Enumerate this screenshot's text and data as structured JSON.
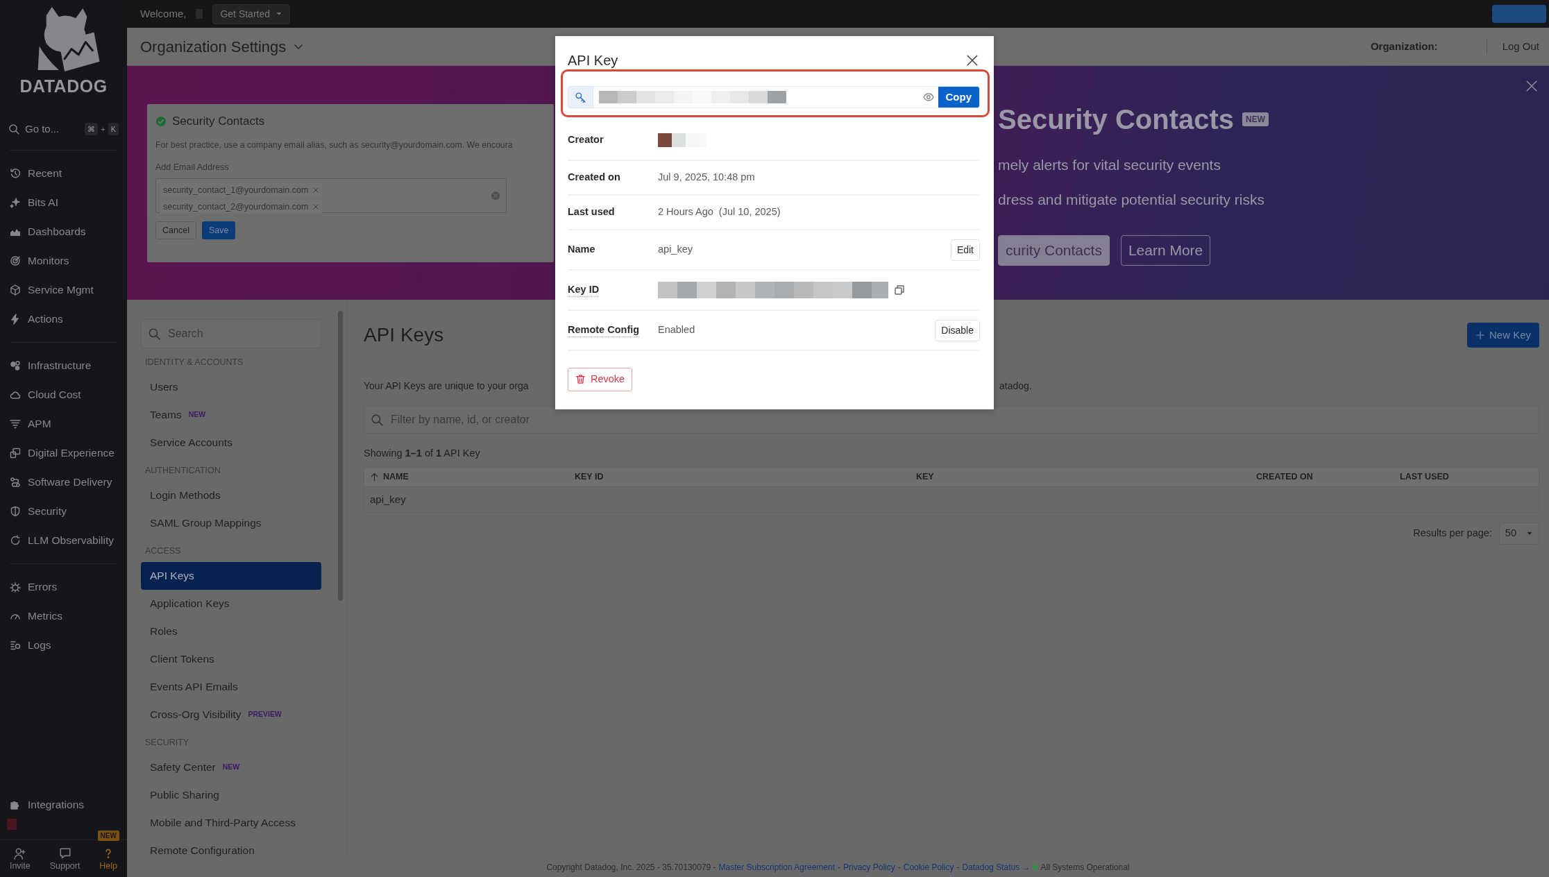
{
  "top_bar": {
    "greeting": "Welcome,",
    "menu_button": "Get Started"
  },
  "main_nav": {
    "logo": "DATADOG",
    "goto": {
      "label": "Go to...",
      "keys": [
        "⌘",
        "K"
      ],
      "joiner": "+"
    },
    "groups": [
      {
        "items": [
          {
            "label": "Recent"
          },
          {
            "label": "Bits AI"
          },
          {
            "label": "Dashboards"
          },
          {
            "label": "Monitors"
          },
          {
            "label": "Service Mgmt"
          },
          {
            "label": "Actions"
          }
        ]
      },
      {
        "items": [
          {
            "label": "Infrastructure"
          },
          {
            "label": "Cloud Cost"
          },
          {
            "label": "APM"
          },
          {
            "label": "Digital Experience"
          },
          {
            "label": "Software Delivery"
          },
          {
            "label": "Security"
          },
          {
            "label": "LLM Observability"
          }
        ]
      },
      {
        "items": [
          {
            "label": "Errors"
          },
          {
            "label": "Metrics"
          },
          {
            "label": "Logs"
          }
        ]
      }
    ],
    "integrations": "Integrations",
    "bottom_buttons": [
      {
        "label": "Invite",
        "highlighted": false
      },
      {
        "label": "Support",
        "highlighted": false
      },
      {
        "label": "Help",
        "highlighted": true,
        "badge": "NEW"
      }
    ]
  },
  "page_header": {
    "title": "Organization Settings",
    "organization_label": "Organization:",
    "logout": "Log Out"
  },
  "banner": {
    "card": {
      "title": "Security Contacts",
      "description": "For best practice, use a company email alias, such as security@yourdomain.com. We encoura",
      "field_label": "Add Email Address",
      "emails": [
        "security_contact_1@yourdomain.com",
        "security_contact_2@yourdomain.com"
      ],
      "buttons": [
        {
          "label": "Cancel",
          "kind": "secondary"
        },
        {
          "label": "Save",
          "kind": "primary"
        }
      ]
    },
    "title": "Security Contacts",
    "badge": "NEW",
    "bullets": [
      "mely alerts for vital security events",
      "dress and mitigate potential security risks"
    ],
    "buttons": [
      {
        "label": "curity Contacts",
        "kind": "primary"
      },
      {
        "label": "Learn More",
        "kind": "secondary"
      }
    ]
  },
  "settings_nav": {
    "search": {
      "placeholder": "Search"
    },
    "sections": [
      {
        "heading": "IDENTITY & ACCOUNTS",
        "items": [
          {
            "label": "Users",
            "selected": false
          },
          {
            "label": "Teams",
            "badge": "NEW",
            "selected": false
          },
          {
            "label": "Service Accounts",
            "selected": false
          }
        ]
      },
      {
        "heading": "AUTHENTICATION",
        "items": [
          {
            "label": "Login Methods",
            "selected": false
          },
          {
            "label": "SAML Group Mappings",
            "selected": false
          }
        ]
      },
      {
        "heading": "ACCESS",
        "items": [
          {
            "label": "API Keys",
            "selected": true
          },
          {
            "label": "Application Keys",
            "selected": false
          },
          {
            "label": "Roles",
            "selected": false
          },
          {
            "label": "Client Tokens",
            "selected": false
          },
          {
            "label": "Events API Emails",
            "selected": false
          },
          {
            "label": "Cross-Org Visibility",
            "badge": "PREVIEW",
            "selected": false
          }
        ]
      },
      {
        "heading": "SECURITY",
        "items": [
          {
            "label": "Safety Center",
            "badge": "NEW",
            "selected": false
          },
          {
            "label": "Public Sharing",
            "selected": false
          },
          {
            "label": "Mobile and Third-Party Access",
            "selected": false
          },
          {
            "label": "Remote Configuration",
            "selected": false
          }
        ]
      }
    ]
  },
  "content": {
    "title": "API Keys",
    "new_button": "New Key",
    "description_parts": [
      "Your API Keys are unique to your orga",
      "atadog."
    ],
    "filter": {
      "placeholder": "Filter by name, id, or creator"
    },
    "summary": "Showing **1–1** of **1** API Key",
    "table": {
      "columns": [
        {
          "label": "NAME",
          "sorted": true
        },
        {
          "label": "KEY ID",
          "sorted": false
        },
        {
          "label": "KEY",
          "sorted": false
        },
        {
          "label": "CREATED ON",
          "sorted": false
        },
        {
          "label": "LAST USED",
          "sorted": false
        }
      ],
      "rows": [
        {
          "cells": [
            "api_key"
          ]
        }
      ]
    },
    "pagination": {
      "label": "Results per page:",
      "value": "50"
    }
  },
  "footer": {
    "copyright": "Copyright Datadog, Inc. 2025 - 35.70130079 -",
    "links": [
      {
        "label": "Master Subscription Agreement",
        "separator": "-"
      },
      {
        "label": "Privacy Policy",
        "separator": "-"
      },
      {
        "label": "Cookie Policy",
        "separator": "-"
      },
      {
        "label": "Datadog Status →"
      }
    ],
    "status": {
      "text": "All Systems Operational",
      "color": "#2f8f46"
    }
  },
  "modal": {
    "title": "API Key",
    "copy_button": "Copy",
    "details": [
      {
        "label": "Creator",
        "kind": "redacted",
        "underlined": false
      },
      {
        "label": "Created on",
        "kind": "text",
        "value": "Jul 9, 2025, 10:48 pm",
        "underlined": false
      },
      {
        "label": "Last used",
        "kind": "text",
        "value": "2 Hours Ago  (Jul 10, 2025)",
        "underlined": false
      },
      {
        "label": "Name",
        "kind": "text",
        "value": "api_key",
        "action": "Edit",
        "underlined": false
      },
      {
        "label": "Key ID",
        "kind": "redacted",
        "underlined": true
      },
      {
        "label": "Remote Config",
        "kind": "text",
        "value": "Enabled",
        "action": "Disable",
        "underlined": true
      }
    ],
    "revoke_button": "Revoke"
  }
}
